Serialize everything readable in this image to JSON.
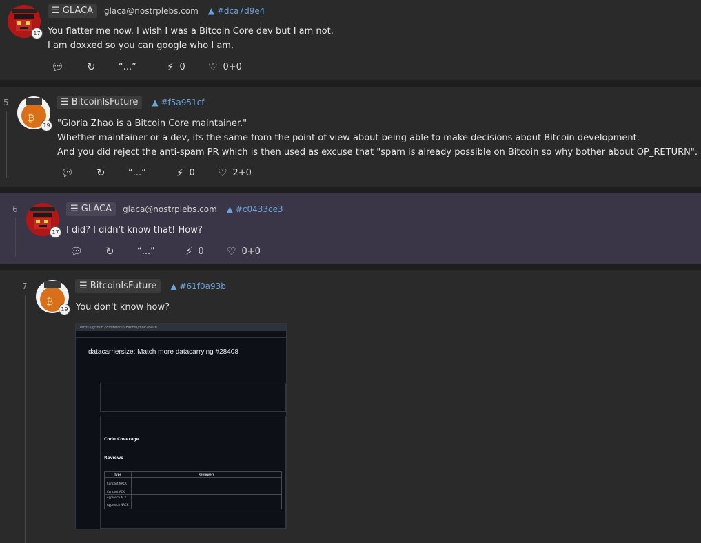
{
  "posts": [
    {
      "number": "",
      "author": "GLACA",
      "nip05": "glaca@nostrplebs.com",
      "pubkey": "#dca7d9e4",
      "badge": "17",
      "lines": [
        "You flatter me now. I wish I was a Bitcoin Core dev but I am not.",
        "I am doxxed so you can google who I am."
      ],
      "actions": {
        "reply": "",
        "repost": "",
        "quote": "“...”",
        "zaps": "0",
        "likes": "0+0"
      }
    },
    {
      "number": "5",
      "author": "BitcoinIsFuture",
      "nip05": "",
      "pubkey": "#f5a951cf",
      "badge": "19",
      "lines": [
        "\"Gloria Zhao is a Bitcoin Core maintainer.\"",
        "Whether maintainer or a dev, its the same from the point of view about being able to make decisions about Bitcoin development.",
        "And you did reject the anti-spam PR which is then used as excuse that \"spam is already possible on Bitcoin so why bother about OP_RETURN\"."
      ],
      "actions": {
        "reply": "",
        "repost": "",
        "quote": "“...”",
        "zaps": "0",
        "likes": "2+0"
      }
    },
    {
      "number": "6",
      "author": "GLACA",
      "nip05": "glaca@nostrplebs.com",
      "pubkey": "#c0433ce3",
      "badge": "17",
      "lines": [
        "I did? I didn't know that! How?"
      ],
      "actions": {
        "reply": "",
        "repost": "",
        "quote": "“...”",
        "zaps": "0",
        "likes": "0+0"
      }
    },
    {
      "number": "7",
      "author": "BitcoinIsFuture",
      "nip05": "",
      "pubkey": "#61f0a93b",
      "badge": "19",
      "lines": [
        "You don't know how?"
      ]
    }
  ],
  "icons": {
    "menu": "hamburger-icon",
    "pubkey": "triangle-up-icon",
    "reply": "speech-bubble-icon",
    "repost": "repost-icon",
    "zap": "lightning-icon",
    "like": "heart-icon"
  },
  "embedded_screenshot": {
    "url": "https://github.com/bitcoin/bitcoin/pull/28408",
    "pr_title": "datacarriersize: Match more datacarrying #28408",
    "section_code_coverage": "Code Coverage",
    "section_reviews": "Reviews",
    "table_header_type": "Type",
    "table_header_reviewers": "Reviewers",
    "table_rows": [
      "Concept NACK",
      "Concept ACK",
      "Approach ACK",
      "Approach NACK"
    ]
  },
  "colors": {
    "background": "#2a2a2a",
    "highlight": "#3a3647",
    "pubkey": "#6ba3dc"
  }
}
